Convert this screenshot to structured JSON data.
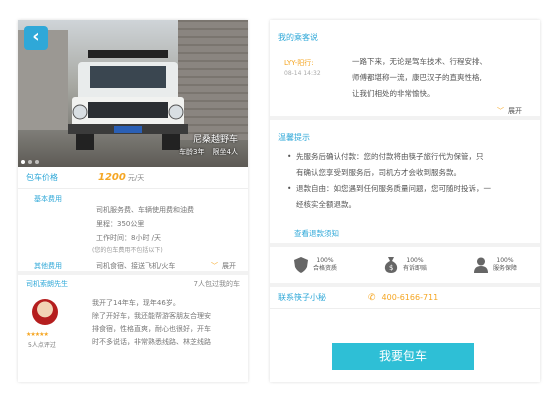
{
  "left": {
    "hero": {
      "car_name": "尼桑越野车",
      "car_age": "车龄3年",
      "seats": "限坐4人",
      "back": "‹"
    },
    "price": {
      "label": "包车价格",
      "value": "1200",
      "unit": "元/天"
    },
    "base_fee": {
      "label": "基本费用",
      "lines": [
        "司机服务费、车辆使用费和油费",
        "里程：350公里",
        "工作时间：8小时 /天"
      ]
    },
    "fee_note": "(您的包车费用不包括以下)",
    "other_fee": {
      "label": "其他费用",
      "value": "司机食宿、接送飞机/火车",
      "expand": "展开"
    },
    "driver": {
      "name": "司机索朗先生",
      "rating_count": "7人包过我的车",
      "stars": "★★★★★",
      "eval_count": "5人点评过",
      "intro": [
        "我开了14年车，现年46岁。",
        "除了开好车，我还能帮游客朋友合理安",
        "排食宿，性格直爽，耐心也很好，开车",
        "时不多说话，非常熟悉线路、林芝线路"
      ]
    }
  },
  "right": {
    "review": {
      "title": "我的乘客说",
      "user": "LYY-阳行:",
      "time": "08-14 14:32",
      "lines": [
        "一路下来，无论是驾车技术、行程安排、",
        "师傅都堪称一流，康巴汉子的直爽性格,",
        "让我们相处的非常愉快。"
      ],
      "expand": "展开"
    },
    "tips": {
      "title": "温馨提示",
      "items": [
        [
          "先服务后确认付款：您的付款将由筷子旅行代为保管，只",
          "有确认您享受到服务后，司机方才会收到服务款。"
        ],
        [
          "退款自由：如您遇到任何服务质量问题，您可随时投诉，一",
          "经核实全额退款。"
        ]
      ],
      "refund_link": "查看退款须知"
    },
    "guarantees": [
      {
        "icon": "shield-icon",
        "pct": "100%",
        "text": "合格资质"
      },
      {
        "icon": "money-bag-icon",
        "pct": "100%",
        "text": "有诉即赔"
      },
      {
        "icon": "person-icon",
        "pct": "100%",
        "text": "服务保障"
      }
    ],
    "contact": {
      "label": "联系筷子小秘",
      "phone": "400-6166-711"
    },
    "book_button": "我要包车"
  },
  "colors": {
    "accent": "#2fa8d8",
    "price": "#f5a623",
    "button": "#2ebfd6"
  }
}
